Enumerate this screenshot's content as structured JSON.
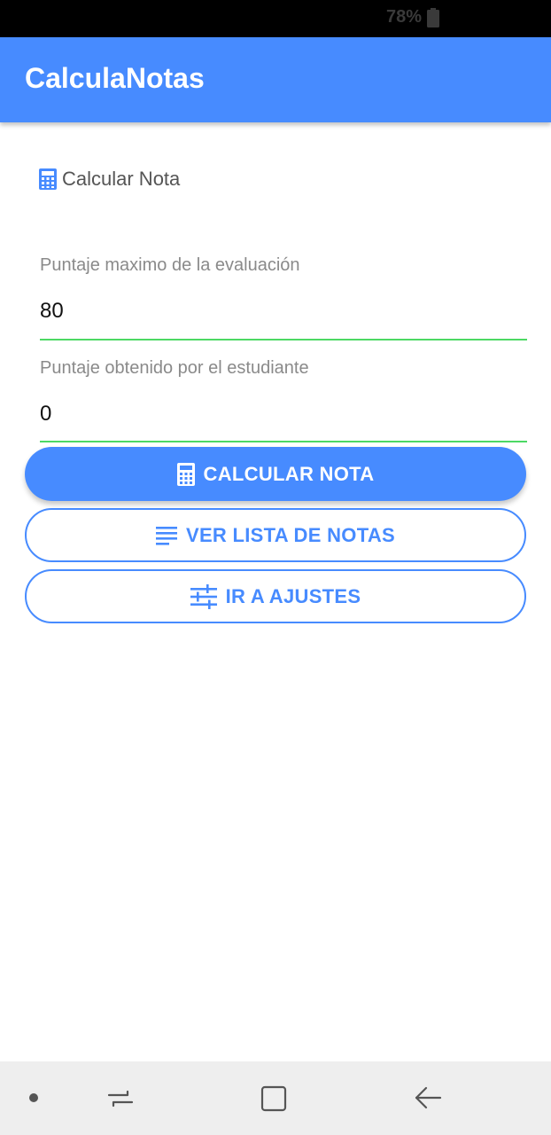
{
  "status_bar": {
    "battery": "78%",
    "battery_icon": "battery-icon"
  },
  "app_bar": {
    "title": "CalculaNotas"
  },
  "section": {
    "icon": "calculator-icon",
    "title": "Calcular Nota"
  },
  "form": {
    "max_score": {
      "label": "Puntaje maximo de la evaluación",
      "value": "80"
    },
    "obtained_score": {
      "label": "Puntaje obtenido por el estudiante",
      "value": "0"
    }
  },
  "buttons": {
    "calculate": {
      "label": "CALCULAR NOTA",
      "icon": "calculator-icon"
    },
    "view_list": {
      "label": "VER LISTA DE NOTAS",
      "icon": "list-icon"
    },
    "settings": {
      "label": "IR A AJUSTES",
      "icon": "sliders-icon"
    }
  },
  "nav_bar": {
    "icons": [
      "dot-icon",
      "recent-apps-icon",
      "home-icon",
      "back-icon"
    ]
  },
  "colors": {
    "primary": "#478bff",
    "input_underline": "#4cd964",
    "status_bar": "#000000",
    "nav_bar": "#eeeeee"
  }
}
